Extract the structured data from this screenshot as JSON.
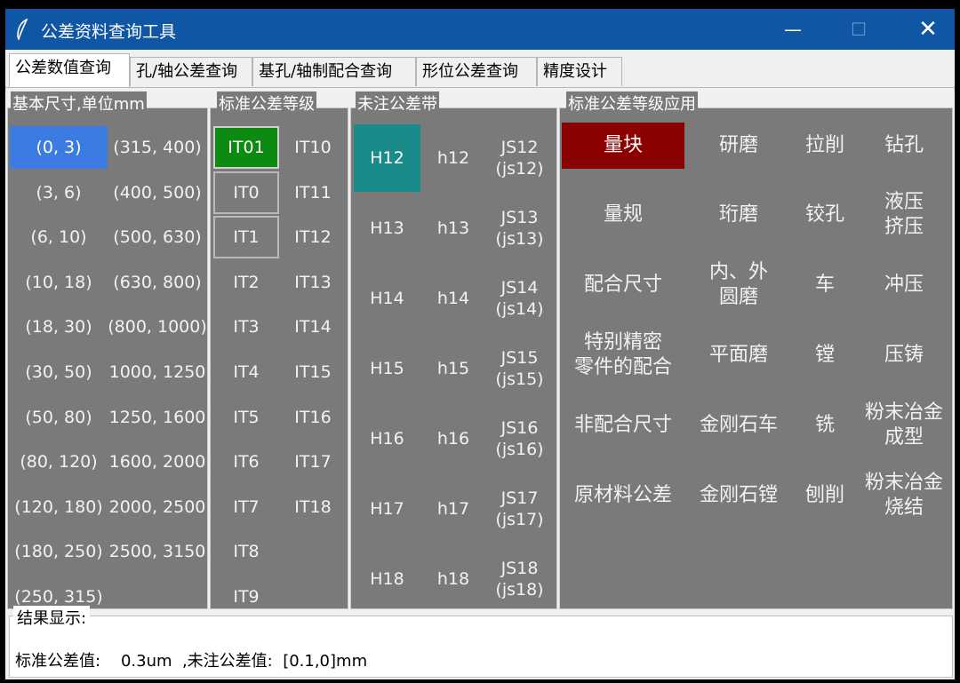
{
  "window": {
    "title": "公差资料查询工具",
    "minimize": "—",
    "maximize": "☐",
    "close": "✕"
  },
  "tabs": [
    "公差数值查询",
    "孔/轴公差查询",
    "基孔/轴制配合查询",
    "形位公差查询",
    "精度设计"
  ],
  "size_panel": {
    "label": "基本尺寸,单位mm",
    "col1": [
      "(0, 3)",
      "(3, 6)",
      "(6, 10)",
      "(10, 18)",
      "(18, 30)",
      "(30, 50)",
      "(50, 80)",
      "(80, 120)",
      "(120, 180)",
      "(180, 250)",
      "(250, 315)"
    ],
    "col2": [
      "(315, 400)",
      "(400, 500)",
      "(500, 630)",
      "(630, 800)",
      "(800, 1000)",
      "(1000, 1250)",
      "(1250, 1600)",
      "(1600, 2000)",
      "(2000, 2500)",
      "(2500, 3150)"
    ]
  },
  "grade_panel": {
    "label": "标准公差等级",
    "col1": [
      "IT01",
      "IT0",
      "IT1",
      "IT2",
      "IT3",
      "IT4",
      "IT5",
      "IT6",
      "IT7",
      "IT8",
      "IT9"
    ],
    "col2": [
      "IT10",
      "IT11",
      "IT12",
      "IT13",
      "IT14",
      "IT15",
      "IT16",
      "IT17",
      "IT18"
    ]
  },
  "band_panel": {
    "label": "未注公差带",
    "rows": [
      [
        "H12",
        "h12",
        "JS12",
        "(js12)"
      ],
      [
        "H13",
        "h13",
        "JS13",
        "(js13)"
      ],
      [
        "H14",
        "h14",
        "JS14",
        "(js14)"
      ],
      [
        "H15",
        "h15",
        "JS15",
        "(js15)"
      ],
      [
        "H16",
        "h16",
        "JS16",
        "(js16)"
      ],
      [
        "H17",
        "h17",
        "JS17",
        "(js17)"
      ],
      [
        "H18",
        "h18",
        "JS18",
        "(js18)"
      ]
    ]
  },
  "app_panel": {
    "label": "标准公差等级应用",
    "rows": [
      [
        [
          "量块"
        ],
        [
          "研磨"
        ],
        [
          "拉削"
        ],
        [
          "钻孔"
        ]
      ],
      [
        [
          "量规"
        ],
        [
          "珩磨"
        ],
        [
          "铰孔"
        ],
        [
          "液压",
          "挤压"
        ]
      ],
      [
        [
          "配合尺寸"
        ],
        [
          "内、外",
          "圆磨"
        ],
        [
          "车"
        ],
        [
          "冲压"
        ]
      ],
      [
        [
          "特别精密",
          "零件的配合"
        ],
        [
          "平面磨"
        ],
        [
          "镗"
        ],
        [
          "压铸"
        ]
      ],
      [
        [
          "非配合尺寸"
        ],
        [
          "金刚石车"
        ],
        [
          "铣"
        ],
        [
          "粉末冶金",
          "成型"
        ]
      ],
      [
        [
          "原材料公差"
        ],
        [
          "金刚石镗"
        ],
        [
          "刨削"
        ],
        [
          "粉末冶金",
          "烧结"
        ]
      ]
    ]
  },
  "result": {
    "label": "结果显示:",
    "text": "标准公差值:    0.3um  ,未注公差值:  [0.1,0]mm"
  },
  "colors": {
    "titlebar": "#0f56a5",
    "panel": "#7a7a7a",
    "size_selected": "#3b7be2",
    "grade_selected": "#0c8a12",
    "band_selected": "#1a8b8b",
    "app_selected": "#8b0000"
  }
}
